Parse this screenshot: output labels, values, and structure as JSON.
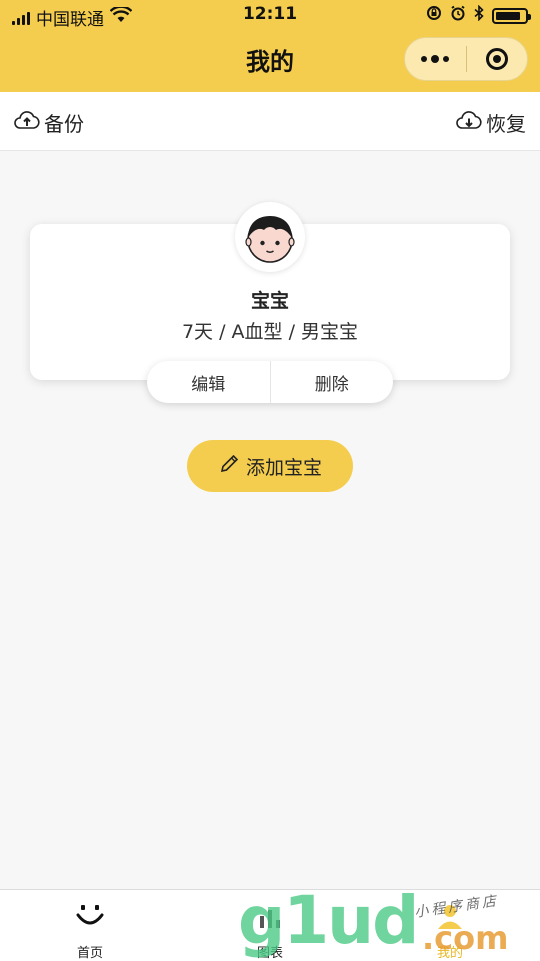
{
  "status_bar": {
    "carrier": "中国联通",
    "time": "12:11",
    "battery_level": 0.85
  },
  "nav": {
    "title": "我的"
  },
  "toolbar": {
    "backup_label": "备份",
    "restore_label": "恢复"
  },
  "baby_card": {
    "name": "宝宝",
    "info": "7天 / A血型 / 男宝宝",
    "edit_label": "编辑",
    "delete_label": "删除"
  },
  "add_button": {
    "label": "添加宝宝"
  },
  "tabbar": {
    "items": [
      {
        "label": "首页",
        "icon": "smile-icon"
      },
      {
        "label": "图表",
        "icon": "chart-icon"
      },
      {
        "label": "我的",
        "icon": "profile-icon"
      }
    ]
  },
  "watermark": {
    "brand": "g1ud",
    "domain": ".com",
    "tagline": "小程序商店"
  },
  "colors": {
    "accent": "#f5cd4e",
    "background": "#f7f7f7"
  }
}
